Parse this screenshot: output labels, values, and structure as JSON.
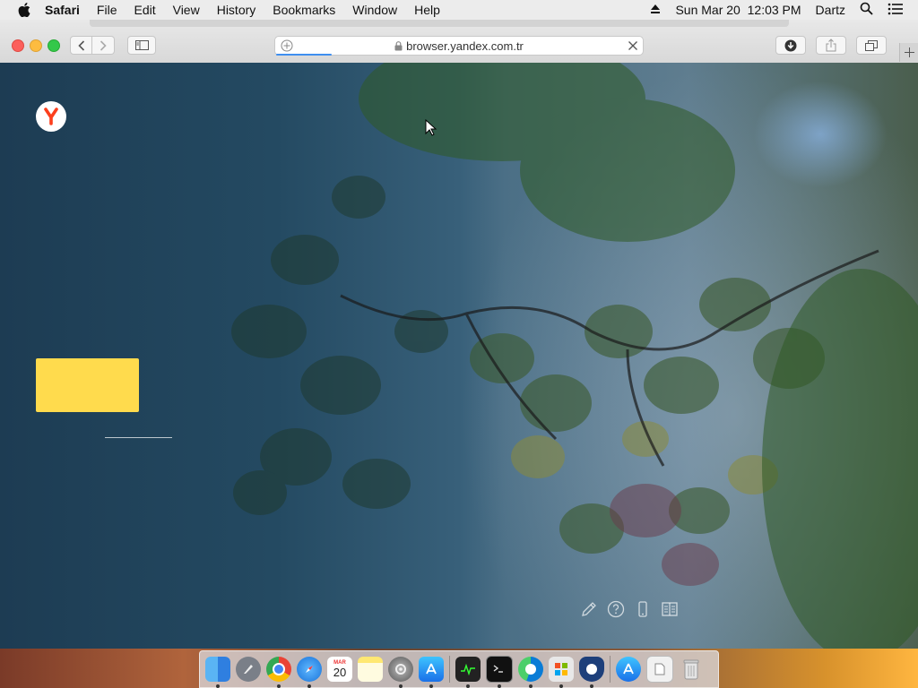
{
  "menubar": {
    "app_name": "Safari",
    "items": [
      "File",
      "Edit",
      "View",
      "History",
      "Bookmarks",
      "Window",
      "Help"
    ],
    "datetime": "Sun Mar 20  12:03 PM",
    "user": "Dartz"
  },
  "toolbar": {
    "url": "browser.yandex.com.tr",
    "load_progress": 0.15
  },
  "dock": {
    "calendar_day": "20",
    "calendar_month": "MAR"
  },
  "colors": {
    "yandex_red": "#fc3f1d",
    "yandex_yellow": "#ffdb4d",
    "progress_blue": "#3f8ff0"
  }
}
